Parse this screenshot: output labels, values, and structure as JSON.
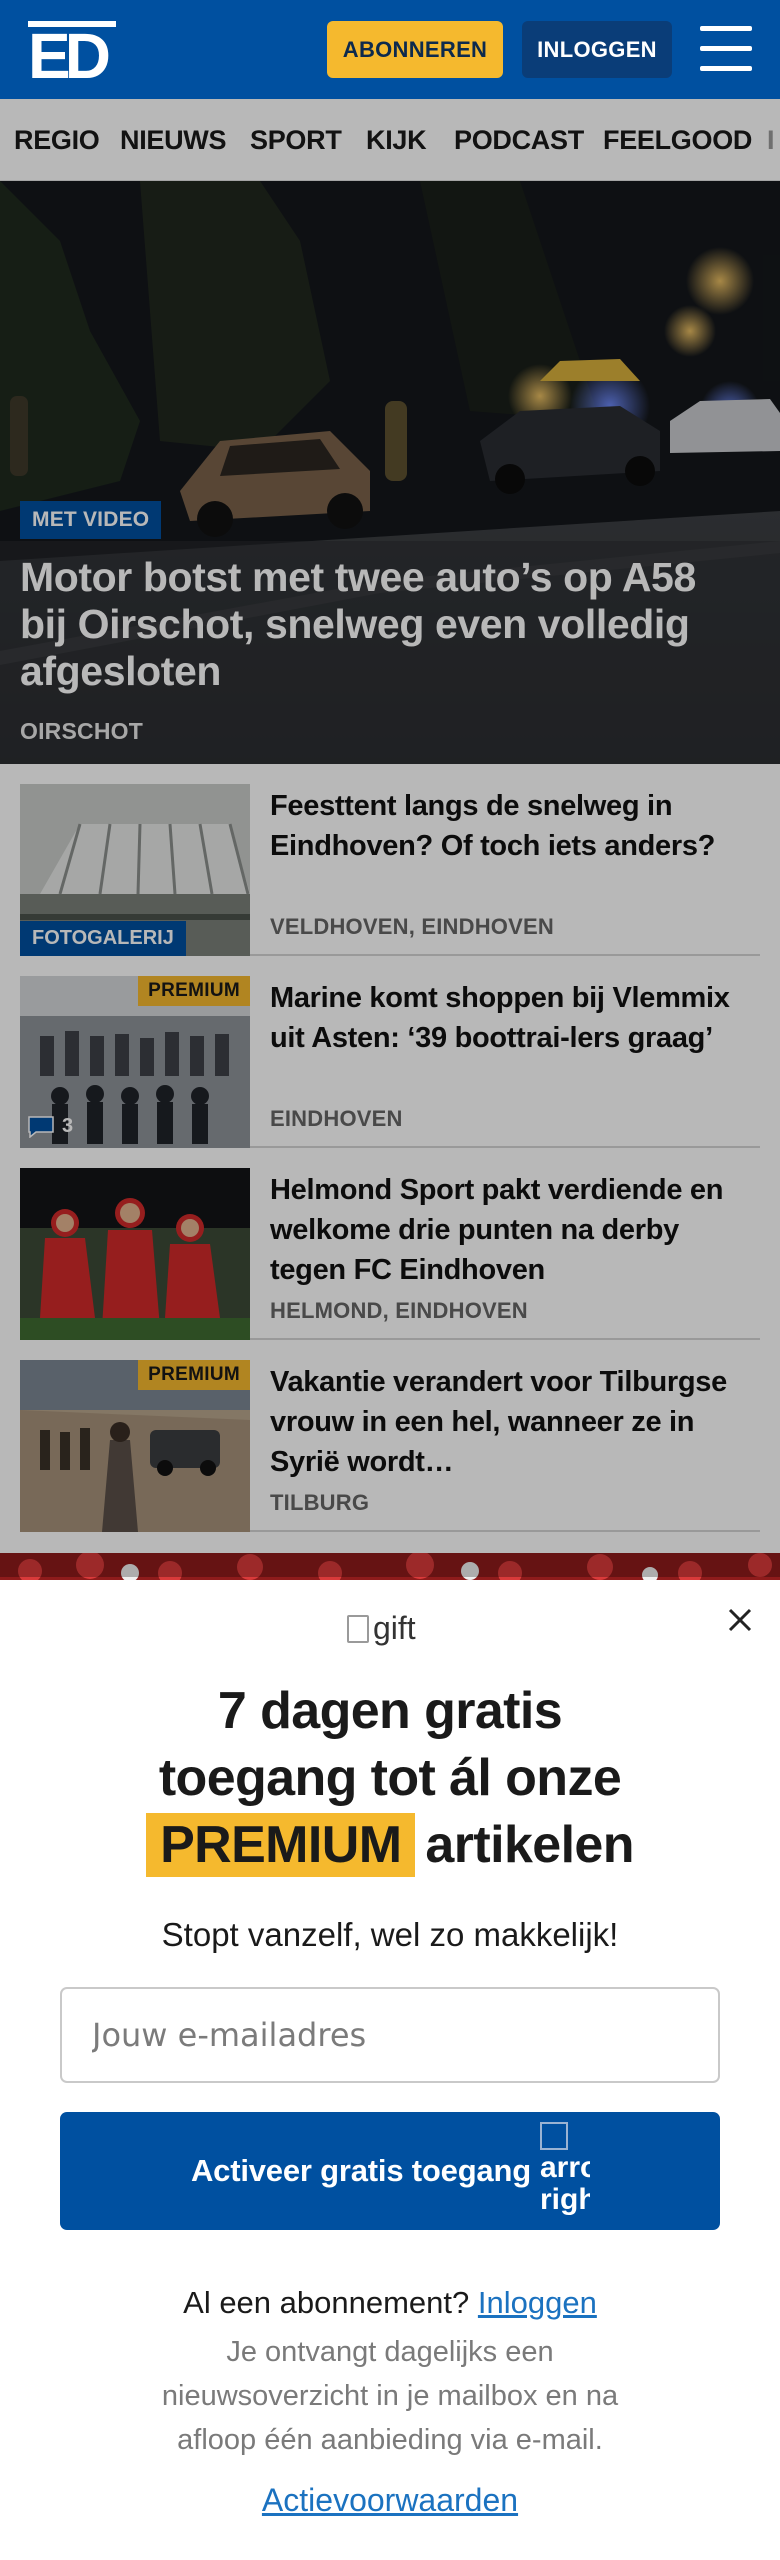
{
  "header": {
    "logo_text": "ED",
    "subscribe_label": "ABONNEREN",
    "login_label": "INLOGGEN",
    "colors": {
      "brand": "#0050a0",
      "accent": "#f5b92e"
    }
  },
  "nav": {
    "items": [
      {
        "label": "REGIO"
      },
      {
        "label": "NIEUWS"
      },
      {
        "label": "SPORT"
      },
      {
        "label": "KIJK"
      },
      {
        "label": "PODCAST"
      },
      {
        "label": "FEELGOOD"
      },
      {
        "label": "I"
      }
    ]
  },
  "hero": {
    "badge": "MET VIDEO",
    "title": "Motor botst met twee auto’s op A58 bij Oirschot, snelweg even volledig afgesloten",
    "location": "OIRSCHOT"
  },
  "articles": [
    {
      "title": "Feesttent langs de snelweg in Eindhoven? Of toch iets anders?",
      "location": "VELDHOVEN, EINDHOVEN",
      "tag": "FOTOGALERIJ"
    },
    {
      "title": "Marine komt shoppen bij Vlemmix uit Asten: ‘39 boottrai-lers graag’",
      "location": "EINDHOVEN",
      "premium": "PREMIUM",
      "comments": "3"
    },
    {
      "title": "Helmond Sport pakt verdiende en welkome drie punten na derby tegen FC Eindhoven",
      "location": "HELMOND, EINDHOVEN"
    },
    {
      "title": "Vakantie verandert voor Tilburgse vrouw in een hel, wanneer ze in Syrië wordt…",
      "location": "TILBURG",
      "premium": "PREMIUM"
    }
  ],
  "popup": {
    "gift_alt": "gift",
    "headline_line1": "7 dagen gratis",
    "headline_line2": "toegang tot ál onze",
    "headline_premium": "PREMIUM",
    "headline_suffix": "artikelen",
    "subline": "Stopt vanzelf, wel zo makkelijk!",
    "email_placeholder": "Jouw e-mailadres",
    "cta_label": "Activeer gratis toegang",
    "cta_icon_alt_1": "arro",
    "cta_icon_alt_2": "righ",
    "account_text": "Al een abonnement?",
    "account_link": "Inloggen",
    "info": "Je ontvangt dagelijks een nieuwsoverzicht in je mailbox en na afloop één aanbieding via e-mail.",
    "terms_link": "Actievoorwaarden"
  }
}
